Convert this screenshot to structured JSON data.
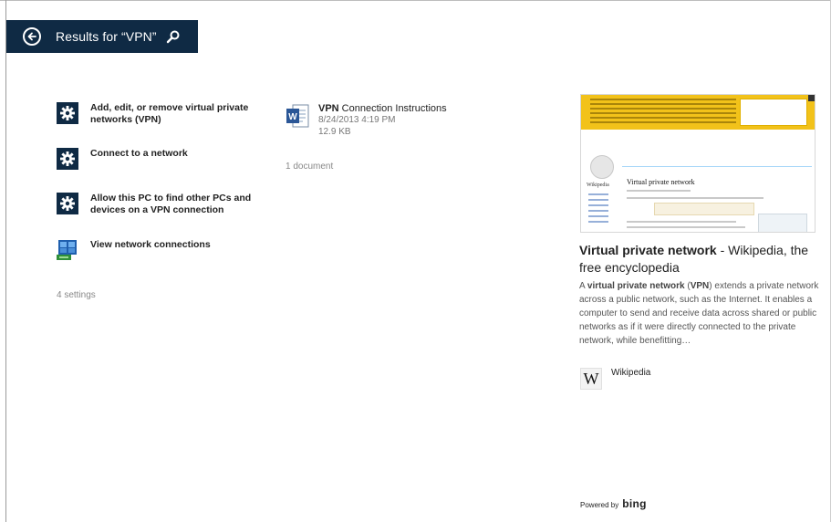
{
  "header": {
    "title": "Results for “VPN”",
    "back_icon": "back-arrow-icon",
    "search_icon": "search-icon",
    "background": "#0f2a44"
  },
  "settings": {
    "items": [
      {
        "label_pre": "Add, edit, or remove virtual private networks (",
        "highlight": "VPN",
        "label_post": ")",
        "icon": "gear-icon"
      },
      {
        "label_pre": "Connect to a network",
        "highlight": "",
        "label_post": "",
        "icon": "gear-icon"
      },
      {
        "label_pre": "Allow this PC to find other PCs and devices on a ",
        "highlight": "VPN",
        "label_post": " connection",
        "icon": "gear-icon"
      },
      {
        "label_pre": "View network connections",
        "highlight": "",
        "label_post": "",
        "icon": "network-connections-icon"
      }
    ],
    "count": "4 settings"
  },
  "documents": {
    "items": [
      {
        "title_highlight": "VPN",
        "title_rest": " Connection Instructions",
        "date": "8/24/2013 4:19 PM",
        "size": "12.9 KB",
        "icon": "word-document-icon"
      }
    ],
    "count": "1 document"
  },
  "web_result": {
    "preview_heading": "Virtual private network",
    "preview_brand": "Wikipedia",
    "title_bold": "Virtual private network",
    "title_rest": " - Wikipedia, the free encyclopedia",
    "snippet": {
      "p1": "A ",
      "b1": "virtual private network",
      "p2": " (",
      "b2": "VPN",
      "p3": ") extends a private network across a public network, such as the Internet. It enables a computer to send and receive data across shared or public networks as if it were directly connected to the private network, while benefitting…"
    },
    "source_label": "Wikipedia",
    "source_icon": "wikipedia-w-icon",
    "banner_color": "#f2c21a"
  },
  "footer": {
    "powered_by": "Powered by",
    "bing": "bing"
  }
}
